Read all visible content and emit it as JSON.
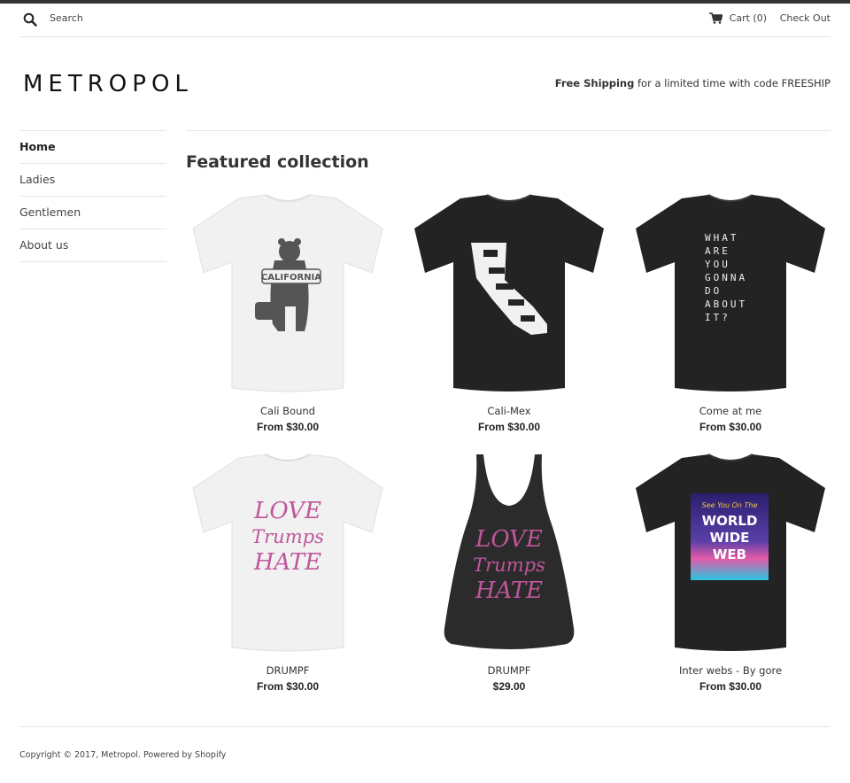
{
  "colors": {
    "accent_bar": "#333333",
    "text": "#333333",
    "divider": "#e5e5e5",
    "pink": "#c0569b"
  },
  "topbar": {
    "search_placeholder": "Search",
    "cart_label": "Cart (0)",
    "checkout_label": "Check Out",
    "icons": {
      "search": "search-icon",
      "cart": "cart-icon"
    }
  },
  "header": {
    "logo": "METROPOL",
    "promo_bold": "Free Shipping",
    "promo_rest": " for a limited time with code FREESHIP"
  },
  "sidebar": {
    "items": [
      {
        "label": "Home",
        "active": true
      },
      {
        "label": "Ladies"
      },
      {
        "label": "Gentlemen"
      },
      {
        "label": "About us"
      }
    ]
  },
  "main": {
    "title": "Featured collection",
    "products": [
      {
        "name": "Cali Bound",
        "price": "From $30.00",
        "shirt_color": "#f1f1f1",
        "graphic": "CALIFORNIA"
      },
      {
        "name": "Cali-Mex",
        "price": "From $30.00",
        "shirt_color": "#232323",
        "graphic": ""
      },
      {
        "name": "Come at me",
        "price": "From $30.00",
        "shirt_color": "#232323",
        "graphic_lines": [
          "WHAT",
          "ARE",
          "YOU",
          "GONNA",
          "DO",
          "ABOUT",
          "IT?"
        ]
      },
      {
        "name": "DRUMPF",
        "price": "From $30.00",
        "shirt_color": "#f1f1f1",
        "graphic_lines": [
          "LOVE",
          "Trumps",
          "HATE"
        ]
      },
      {
        "name": "DRUMPF",
        "price": "$29.00",
        "shirt_color": "#2b2b2b",
        "graphic_lines": [
          "LOVE",
          "Trumps",
          "HATE"
        ]
      },
      {
        "name": "Inter webs - By gore",
        "price": "From $30.00",
        "shirt_color": "#232323",
        "graphic_lines": [
          "See You On The",
          "WORLD",
          "WIDE",
          "WEB"
        ]
      }
    ]
  },
  "footer": {
    "copyright": "Copyright © 2017, Metropol. Powered by Shopify"
  }
}
